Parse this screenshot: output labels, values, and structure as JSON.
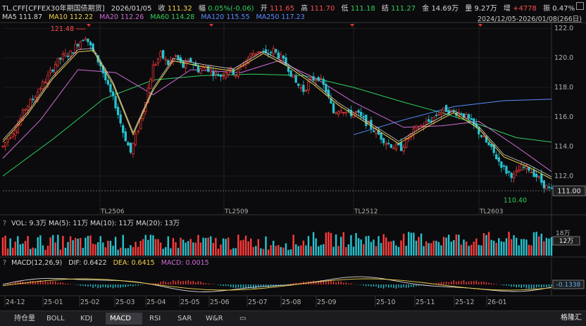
{
  "header": {
    "symbol": "TL.CFF[CFFEX30年期国债期货]",
    "date": "2026/01/05",
    "close_label": "收",
    "close": "111.32",
    "change_label": "幅",
    "change": "0.05%(-0.06)",
    "open_label": "开",
    "open": "111.65",
    "high_label": "高",
    "high": "111.70",
    "low_label": "低",
    "low": "111.18",
    "settle_label": "结",
    "settle": "111.27",
    "amount_label": "金",
    "amount": "14.69万",
    "volume_label": "量",
    "volume": "9.27万",
    "oi_label": "增",
    "oi": "+4778",
    "amp_label": "振",
    "amp": "0.47%",
    "ma": [
      {
        "label": "MA5",
        "value": "111.87",
        "color": "#d9d9d9"
      },
      {
        "label": "MA10",
        "value": "112.22",
        "color": "#f3d34a"
      },
      {
        "label": "MA20",
        "value": "112.26",
        "color": "#d16bd6"
      },
      {
        "label": "MA60",
        "value": "114.28",
        "color": "#2fcf5a"
      },
      {
        "label": "MA120",
        "value": "115.55",
        "color": "#5a8cff"
      },
      {
        "label": "MA250",
        "value": "117.23",
        "color": "#5a8cff"
      }
    ],
    "range": "2024/12/05-2026/01/08(266日)"
  },
  "chart_data": {
    "type": "line",
    "title": "TL.CFF",
    "ylim": [
      110.0,
      122.2
    ],
    "y_ticks": [
      "122.0",
      "120.0",
      "118.0",
      "116.0",
      "114.0",
      "112.0",
      "111.00"
    ],
    "last_price_tag": "111.00",
    "max_label": "121.48",
    "min_label": "110.40",
    "contract_labels": [
      "TL2506",
      "TL2509",
      "TL2512",
      "TL2603"
    ],
    "x_labels": [
      "24-12",
      "25-01",
      "25-02",
      "25-03",
      "25-04",
      "25-05",
      "25-06",
      "25-07",
      "25-08",
      "25-09",
      "25-10",
      "25-11",
      "25-12",
      "26-01"
    ],
    "price_path": [
      [
        0,
        114.0
      ],
      [
        3,
        114.8
      ],
      [
        6,
        115.5
      ],
      [
        9,
        116.6
      ],
      [
        12,
        117.2
      ],
      [
        15,
        118.0
      ],
      [
        18,
        118.7
      ],
      [
        21,
        119.6
      ],
      [
        24,
        120.1
      ],
      [
        27,
        120.3
      ],
      [
        30,
        121.0
      ],
      [
        33,
        121.48
      ],
      [
        36,
        120.4
      ],
      [
        39,
        119.5
      ],
      [
        42,
        118.0
      ],
      [
        45,
        116.8
      ],
      [
        48,
        115.0
      ],
      [
        51,
        113.6
      ],
      [
        54,
        115.2
      ],
      [
        57,
        117.2
      ],
      [
        60,
        119.4
      ],
      [
        63,
        120.2
      ],
      [
        66,
        119.6
      ],
      [
        69,
        120.1
      ],
      [
        72,
        119.4
      ],
      [
        75,
        119.8
      ],
      [
        78,
        119.2
      ],
      [
        81,
        119.4
      ],
      [
        84,
        119.0
      ],
      [
        87,
        118.8
      ],
      [
        90,
        119.3
      ],
      [
        93,
        118.9
      ],
      [
        96,
        119.6
      ],
      [
        99,
        120.2
      ],
      [
        102,
        120.5
      ],
      [
        105,
        120.2
      ],
      [
        108,
        120.5
      ],
      [
        111,
        120.0
      ],
      [
        114,
        119.3
      ],
      [
        117,
        118.3
      ],
      [
        120,
        117.8
      ],
      [
        123,
        118.5
      ],
      [
        126,
        118.7
      ],
      [
        129,
        117.8
      ],
      [
        132,
        116.3
      ],
      [
        135,
        116.6
      ],
      [
        138,
        116.2
      ],
      [
        141,
        116.3
      ],
      [
        144,
        115.8
      ],
      [
        147,
        115.3
      ],
      [
        150,
        114.8
      ],
      [
        153,
        114.3
      ],
      [
        156,
        114.0
      ],
      [
        159,
        113.9
      ],
      [
        162,
        114.6
      ],
      [
        165,
        115.2
      ],
      [
        168,
        115.5
      ],
      [
        171,
        115.8
      ],
      [
        174,
        116.3
      ],
      [
        177,
        116.5
      ],
      [
        180,
        116.3
      ],
      [
        183,
        116.3
      ],
      [
        186,
        115.8
      ],
      [
        189,
        115.2
      ],
      [
        192,
        114.5
      ],
      [
        195,
        113.8
      ],
      [
        198,
        113.0
      ],
      [
        201,
        112.3
      ],
      [
        204,
        112.0
      ],
      [
        207,
        112.6
      ],
      [
        210,
        112.5
      ],
      [
        213,
        112.0
      ],
      [
        216,
        111.4
      ],
      [
        219,
        111.0
      ]
    ],
    "ma_short": [
      [
        0,
        114.3
      ],
      [
        10,
        116.2
      ],
      [
        20,
        118.6
      ],
      [
        30,
        120.4
      ],
      [
        36,
        120.5
      ],
      [
        44,
        118.2
      ],
      [
        52,
        114.8
      ],
      [
        60,
        117.8
      ],
      [
        68,
        119.8
      ],
      [
        80,
        119.4
      ],
      [
        92,
        119.1
      ],
      [
        104,
        120.3
      ],
      [
        114,
        119.4
      ],
      [
        124,
        118.2
      ],
      [
        134,
        116.8
      ],
      [
        146,
        115.5
      ],
      [
        158,
        114.2
      ],
      [
        170,
        115.4
      ],
      [
        180,
        116.3
      ],
      [
        190,
        115.2
      ],
      [
        200,
        113.3
      ],
      [
        210,
        112.6
      ],
      [
        219,
        111.8
      ]
    ],
    "ma60": [
      [
        0,
        112.0
      ],
      [
        20,
        114.5
      ],
      [
        40,
        117.2
      ],
      [
        60,
        118.5
      ],
      [
        80,
        118.8
      ],
      [
        100,
        118.9
      ],
      [
        120,
        118.8
      ],
      [
        140,
        118.0
      ],
      [
        160,
        117.0
      ],
      [
        175,
        116.3
      ],
      [
        190,
        115.5
      ],
      [
        205,
        114.6
      ],
      [
        219,
        114.3
      ]
    ],
    "ma120": [
      [
        140,
        114.8
      ],
      [
        160,
        115.8
      ],
      [
        180,
        116.7
      ],
      [
        200,
        117.1
      ],
      [
        219,
        117.2
      ]
    ],
    "ma20": [
      [
        0,
        113.2
      ],
      [
        15,
        115.8
      ],
      [
        30,
        119.2
      ],
      [
        45,
        119.0
      ],
      [
        60,
        117.5
      ],
      [
        75,
        119.2
      ],
      [
        95,
        119.0
      ],
      [
        110,
        119.8
      ],
      [
        125,
        118.6
      ],
      [
        140,
        117.0
      ],
      [
        160,
        115.3
      ],
      [
        175,
        115.4
      ],
      [
        190,
        115.7
      ],
      [
        205,
        114.0
      ],
      [
        219,
        112.3
      ]
    ],
    "volume_bar": {
      "label": "VOL: 9.3万  MA(5): 11万  MA(10): 11万  MA(20): 13万",
      "ticks": [
        "18万",
        "12万"
      ]
    },
    "macd_bar": {
      "label_macd": "MACD(12,26,9)",
      "dif": "DIF: 0.6422",
      "dea": "DEA: 0.6415",
      "macd": "MACD: 0.0015",
      "tag": "-0.1338"
    }
  },
  "tabs": [
    "持仓量",
    "BOLL",
    "KDJ",
    "MACD",
    "RSI",
    "SAR",
    "W&R"
  ],
  "active_tab": "MACD",
  "brand": "格隆汇"
}
